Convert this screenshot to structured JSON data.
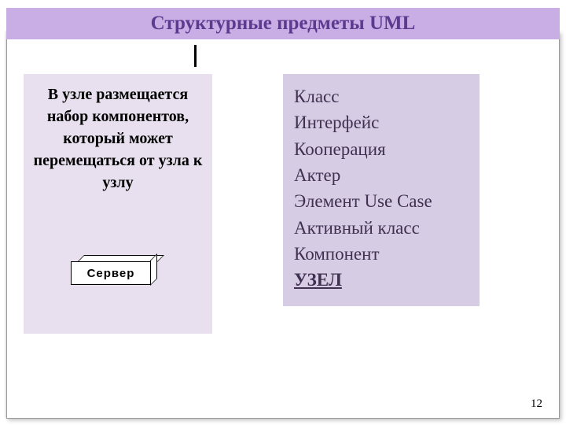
{
  "title": "Структурные предметы UML",
  "left": {
    "description": "В узле размещается набор компонентов, который может перемещаться от узла к узлу",
    "server_label": "Сервер"
  },
  "right": {
    "items": [
      "Класс",
      "Интерфейс",
      "Кооперация",
      "Актер",
      "Элемент Use Case",
      "Активный класс",
      "Компонент",
      "УЗЕЛ"
    ]
  },
  "page_number": "12"
}
